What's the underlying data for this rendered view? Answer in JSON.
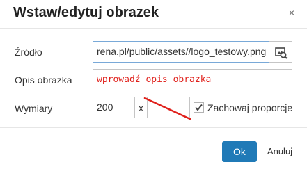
{
  "dialog": {
    "title": "Wstaw/edytuj obrazek",
    "close_label": "×"
  },
  "source": {
    "label": "Źródło",
    "value": "rena.pl/public/assets//logo_testowy.png",
    "browse_icon": "image-search-icon"
  },
  "description": {
    "label": "Opis obrazka",
    "value": "wprowadź opis obrazka",
    "value_color": "#e0201b"
  },
  "dimensions": {
    "label": "Wymiary",
    "width_value": "200",
    "separator": "x",
    "height_value": "",
    "constrain_label": "Zachowaj proporcje",
    "constrain_checked": true
  },
  "footer": {
    "ok_label": "Ok",
    "cancel_label": "Anuluj"
  },
  "colors": {
    "primary": "#207ab7",
    "annotation": "#e0201b"
  }
}
